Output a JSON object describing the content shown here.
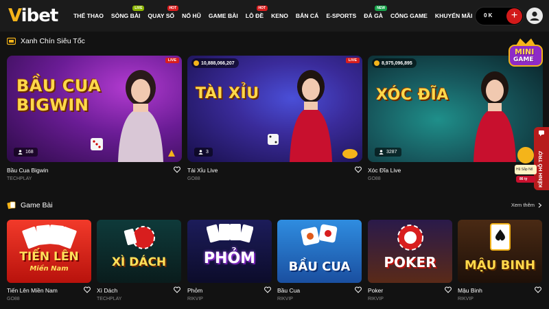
{
  "header": {
    "logo": "Vibet",
    "nav": [
      {
        "label": "THỂ THAO",
        "badge": ""
      },
      {
        "label": "SÒNG BÀI",
        "badge": "LIVE"
      },
      {
        "label": "QUAY SỐ",
        "badge": "HOT"
      },
      {
        "label": "NỔ HŨ",
        "badge": ""
      },
      {
        "label": "GAME BÀI",
        "badge": ""
      },
      {
        "label": "LÔ ĐỀ",
        "badge": "HOT"
      },
      {
        "label": "KENO",
        "badge": ""
      },
      {
        "label": "BẮN CÁ",
        "badge": ""
      },
      {
        "label": "E-SPORTS",
        "badge": ""
      },
      {
        "label": "ĐÁ GÀ",
        "badge": "NEW"
      },
      {
        "label": "CỔNG GAME",
        "badge": ""
      },
      {
        "label": "KHUYẾN MÃI",
        "badge": ""
      }
    ],
    "balance": "0 K",
    "plus": "+"
  },
  "live_section": {
    "title": "Xanh Chín Siêu Tốc",
    "cards": [
      {
        "art_title_1": "BẦU CUA",
        "art_title_2": "BIGWIN",
        "name": "Bầu Cua Bigwin",
        "provider": "TECHPLAY",
        "viewers": "168",
        "jackpot": "",
        "badge": "LIVE"
      },
      {
        "art_title_1": "TÀI XỈU",
        "art_title_2": "",
        "name": "Tài Xỉu Live",
        "provider": "GO88",
        "viewers": "3",
        "jackpot": "10,888,066,207",
        "badge": "LIVE"
      },
      {
        "art_title_1": "XÓC ĐĨA",
        "art_title_2": "",
        "name": "Xóc Đĩa Live",
        "provider": "GO88",
        "viewers": "3287",
        "jackpot": "8,975,096,895",
        "badge": ""
      }
    ]
  },
  "game_section": {
    "title": "Game Bài",
    "see_more": "Xem thêm",
    "cards": [
      {
        "art_title": "TIẾN LÊN",
        "art_sub": "Miền Nam",
        "name": "Tiến Lên Miền Nam",
        "provider": "GO88"
      },
      {
        "art_title": "XÌ DÁCH",
        "art_sub": "",
        "name": "Xì Dách",
        "provider": "TECHPLAY"
      },
      {
        "art_title": "PHỎM",
        "art_sub": "",
        "name": "Phỏm",
        "provider": "RIKVIP"
      },
      {
        "art_title": "BẦU CUA",
        "art_sub": "",
        "name": "Bầu Cua",
        "provider": "RIKVIP"
      },
      {
        "art_title": "POKER",
        "art_sub": "",
        "name": "Poker",
        "provider": "RIKVIP"
      },
      {
        "art_title": "MẬU BINH",
        "art_sub": "",
        "name": "Mậu Binh",
        "provider": "RIKVIP"
      }
    ]
  },
  "widgets": {
    "mini_game_1": "MINI",
    "mini_game_2": "GAME",
    "support_tab": "KÊNH HỖ TRỢ",
    "jackpot_label": "Hũ Sắp Nổ",
    "jackpot_value": "86 tỷ"
  },
  "colors": {
    "accent": "#f4b41a",
    "live_red": "#d81e1e",
    "background": "#121212",
    "header": "#1b1b1b"
  }
}
